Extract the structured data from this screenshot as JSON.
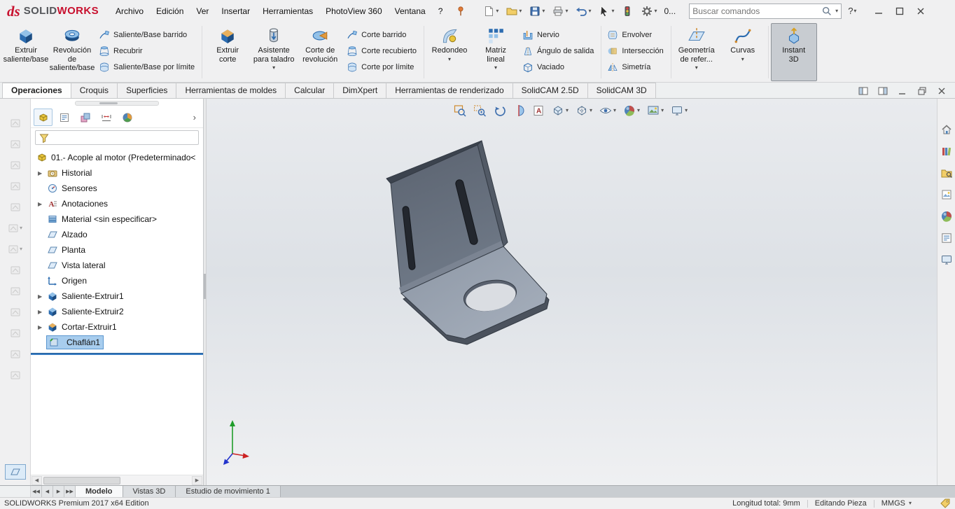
{
  "titlebar": {
    "logo_ds": "ds",
    "logo_brand_1": "SOLID",
    "logo_brand_2": "WORKS",
    "menus": [
      "Archivo",
      "Edición",
      "Ver",
      "Insertar",
      "Herramientas",
      "PhotoView 360",
      "Ventana",
      "?"
    ],
    "overflow": "0...",
    "search_placeholder": "Buscar comandos",
    "help": "?"
  },
  "ribbon": {
    "big_buttons": [
      {
        "label": "Extruir\nsaliente/base"
      },
      {
        "label": "Revolución\nde\nsaliente/base"
      },
      {
        "label": "Extruir\ncorte"
      },
      {
        "label": "Asistente\npara taladro"
      },
      {
        "label": "Corte de\nrevolución"
      },
      {
        "label": "Redondeo"
      },
      {
        "label": "Matriz\nlineal"
      },
      {
        "label": "Geometría\nde refer..."
      },
      {
        "label": "Curvas"
      },
      {
        "label": "Instant\n3D"
      }
    ],
    "small_buttons": [
      "Saliente/Base barrido",
      "Recubrir",
      "Saliente/Base por límite",
      "Corte barrido",
      "Corte recubierto",
      "Corte por límite",
      "Nervio",
      "Ángulo de salida",
      "Vaciado",
      "Envolver",
      "Intersección",
      "Simetría"
    ]
  },
  "command_tabs": [
    "Operaciones",
    "Croquis",
    "Superficies",
    "Herramientas de moldes",
    "Calcular",
    "DimXpert",
    "Herramientas de renderizado",
    "SolidCAM 2.5D",
    "SolidCAM 3D"
  ],
  "feature_tree": {
    "root": "01.- Acople al motor (Predeterminado<",
    "items": [
      {
        "label": "Historial"
      },
      {
        "label": "Sensores"
      },
      {
        "label": "Anotaciones"
      },
      {
        "label": "Material <sin especificar>"
      },
      {
        "label": "Alzado"
      },
      {
        "label": "Planta"
      },
      {
        "label": "Vista lateral"
      },
      {
        "label": "Origen"
      },
      {
        "label": "Saliente-Extruir1"
      },
      {
        "label": "Saliente-Extruir2"
      },
      {
        "label": "Cortar-Extruir1"
      },
      {
        "label": "Chaflán1"
      }
    ]
  },
  "model_tabs": [
    "Modelo",
    "Vistas 3D",
    "Estudio de movimiento 1"
  ],
  "statusbar": {
    "edition": "SOLIDWORKS Premium 2017 x64 Edition",
    "total_length": "Longitud total: 9mm",
    "mode": "Editando Pieza",
    "units": "MMGS"
  },
  "colors": {
    "selection_fill": "#a8cdee",
    "selection_border": "#5a96cf",
    "rollback_bar": "#3a7cc2",
    "model_vertical_face": "#646d7a",
    "model_horizontal_face": "#9aa4b2",
    "logo_red": "#c8102e"
  },
  "icons": {
    "titlebar": [
      "new-document",
      "open",
      "save",
      "print",
      "undo",
      "select-cursor",
      "rebuild-stoplight",
      "options-gear",
      "pin",
      "search-magnifier",
      "help",
      "minimize",
      "maximize",
      "close"
    ],
    "heads_up": [
      "zoom-to-fit",
      "zoom-to-area",
      "previous-view",
      "section-view",
      "annotation-views",
      "view-orientation",
      "display-style",
      "hide-show-items",
      "edit-appearance",
      "apply-scene",
      "view-settings"
    ],
    "feature_manager_tabs": [
      "feature-manager",
      "property-manager",
      "configuration-manager",
      "dimxpert-manager",
      "display-manager",
      "expand"
    ],
    "task_pane": [
      "resources-home",
      "design-library",
      "file-explorer",
      "view-palette",
      "appearances-scenes",
      "custom-properties",
      "solidworks-forum"
    ],
    "document_window": [
      "display-pane",
      "task-pane-toggle",
      "minimize",
      "restore",
      "close"
    ]
  }
}
